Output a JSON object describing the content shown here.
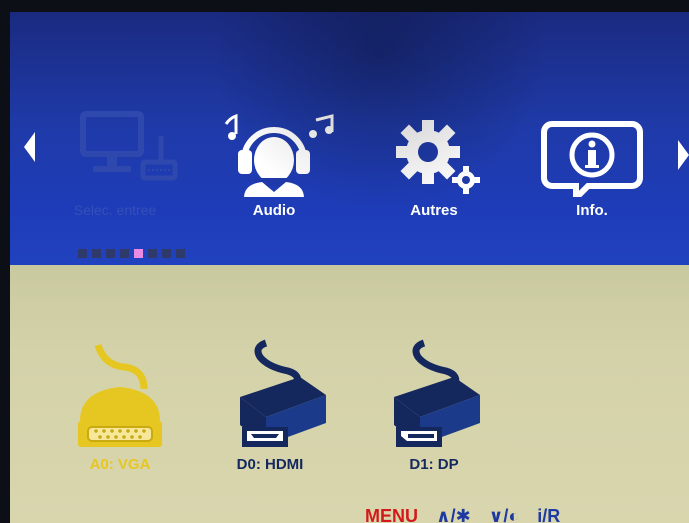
{
  "menu": {
    "items": [
      {
        "label": "Selec. entree",
        "icon": "monitor-input-icon",
        "state": "dimmed"
      },
      {
        "label": "Audio",
        "icon": "headphones-person-icon"
      },
      {
        "label": "Autres",
        "icon": "gears-icon"
      },
      {
        "label": "Info.",
        "icon": "info-icon"
      }
    ],
    "arrows": {
      "left": "triangle-left-icon",
      "right": "triangle-right-icon"
    },
    "page_indicator": {
      "count": 8,
      "active_index": 4
    }
  },
  "sources": [
    {
      "label": "A0: VGA",
      "icon": "vga-connector-icon",
      "selected": true
    },
    {
      "label": "D0: HDMI",
      "icon": "hdmi-connector-icon",
      "selected": false
    },
    {
      "label": "D1: DP",
      "icon": "displayport-connector-icon",
      "selected": false
    }
  ],
  "footer": {
    "menu": "MENU",
    "hint_up": "∧/✱",
    "hint_down": "∨/◐",
    "hint_exit": "i/R"
  },
  "colors": {
    "bar_blue": "#1e3cb8",
    "content_bg": "#d4d2a9",
    "selected_yellow": "#e6c722",
    "dim_blue": "#3550b8",
    "icon_navy": "#14285e",
    "menu_red": "#d11b1b",
    "dot_active": "#e98ae3"
  }
}
